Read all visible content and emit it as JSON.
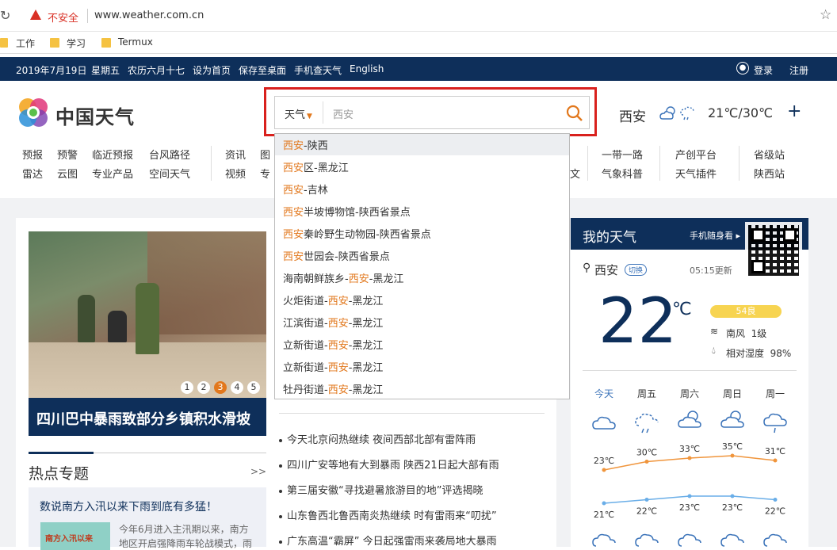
{
  "browser": {
    "security_label": "不安全",
    "url": "www.weather.com.cn",
    "bookmarks": [
      "工作",
      "学习",
      "Termux"
    ]
  },
  "topbar": {
    "date": "2019年7月19日",
    "weekday": "星期五",
    "lunar": "农历六月十七",
    "set_home": "设为首页",
    "save_desktop": "保存至桌面",
    "mobile": "手机查天气",
    "english": "English",
    "login": "登录",
    "register": "注册"
  },
  "logo": {
    "text": "中国天气"
  },
  "search": {
    "type_label": "天气",
    "query": "西安"
  },
  "header_weather": {
    "city": "西安",
    "temp": "21℃/30℃",
    "add": "+"
  },
  "nav_cols": [
    [
      "预报",
      "雷达"
    ],
    [
      "预警",
      "云图"
    ],
    [
      "临近预报",
      "专业产品"
    ],
    [
      "台风路径",
      "空间天气"
    ],
    [
      "资讯",
      "视频"
    ],
    [
      "图",
      "专"
    ],
    [
      "",
      "文"
    ],
    [
      "一带一路",
      "气象科普"
    ],
    [
      "产创平台",
      "天气插件"
    ],
    [
      "省级站",
      "陕西站"
    ]
  ],
  "suggestions": [
    {
      "pre": "",
      "hl": "西安",
      "post": "-陕西"
    },
    {
      "pre": "",
      "hl": "西安",
      "post": "区-黑龙江"
    },
    {
      "pre": "",
      "hl": "西安",
      "post": "-吉林"
    },
    {
      "pre": "",
      "hl": "西安",
      "post": "半坡博物馆-陕西省景点"
    },
    {
      "pre": "",
      "hl": "西安",
      "post": "秦岭野生动物园-陕西省景点"
    },
    {
      "pre": "",
      "hl": "西安",
      "post": "世园会-陕西省景点"
    },
    {
      "pre": "海南朝鲜族乡-",
      "hl": "西安",
      "post": "-黑龙江"
    },
    {
      "pre": "火炬街道-",
      "hl": "西安",
      "post": "-黑龙江"
    },
    {
      "pre": "江滨街道-",
      "hl": "西安",
      "post": "-黑龙江"
    },
    {
      "pre": "立新街道-",
      "hl": "西安",
      "post": "-黑龙江"
    },
    {
      "pre": "立新街道-",
      "hl": "西安",
      "post": "-黑龙江"
    },
    {
      "pre": "牡丹街道-",
      "hl": "西安",
      "post": "-黑龙江"
    }
  ],
  "feature": {
    "caption": "四川巴中暴雨致部分乡镇积水滑坡",
    "pages": [
      "1",
      "2",
      "3",
      "4",
      "5"
    ],
    "active_page": 3
  },
  "hot": {
    "title": "热点专题",
    "more": ">>",
    "subtitle": "数说南方入汛以来下雨到底有多猛！",
    "text1": "今年6月进入主汛期以来，南方",
    "text2": "地区开启强降雨车轮战模式，雨",
    "thumb_text": "南方入汛以来"
  },
  "news": [
    "今天北京闷热继续 夜间西部北部有雷阵雨",
    "四川广安等地有大到暴雨  陕西21日起大部有雨",
    "第三届安徽“寻找避暑旅游目的地”评选揭晓",
    "山东鲁西北鲁西南炎热继续 时有雷雨来“叨扰”",
    "广东高温“霸屏”  今日起强雷雨来袭局地大暴雨"
  ],
  "my_weather": {
    "title": "我的天气",
    "mobile_link": "手机随身看 ▸",
    "city": "西安",
    "switch": "切换",
    "updated": "05:15更新",
    "temp": "22",
    "unit": "℃",
    "aqi": "54良",
    "wind": "南风  1级",
    "humidity": "相对湿度  98%",
    "days": [
      "今天",
      "周五",
      "周六",
      "周日",
      "周一"
    ],
    "highs": [
      "23℃",
      "30℃",
      "33℃",
      "35℃",
      "31℃"
    ],
    "lows": [
      "21℃",
      "22℃",
      "23℃",
      "23℃",
      "22℃"
    ]
  },
  "colors": {
    "topbar": "#0e2f5a",
    "accent": "#e2781d",
    "highlight_box": "#d9211d"
  },
  "chart_data": {
    "type": "line",
    "categories": [
      "今天",
      "周五",
      "周六",
      "周日",
      "周一"
    ],
    "series": [
      {
        "values": [
          23,
          30,
          33,
          35,
          31
        ]
      },
      {
        "values": [
          21,
          22,
          23,
          23,
          22
        ]
      }
    ]
  }
}
